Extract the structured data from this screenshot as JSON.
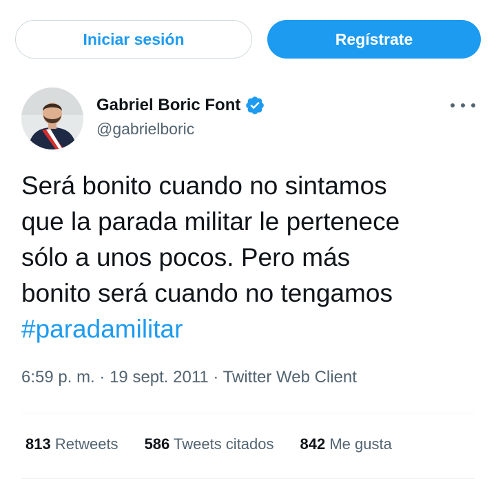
{
  "auth": {
    "login_label": "Iniciar sesión",
    "signup_label": "Regístrate"
  },
  "author": {
    "name": "Gabriel Boric Font",
    "handle": "@gabrielboric",
    "verified": true,
    "avatar_icon": "profile-photo"
  },
  "tweet": {
    "text_lines": [
      "Será bonito cuando no sintamos",
      "que la parada militar le pertenece",
      "sólo a unos pocos. Pero más",
      "bonito será cuando no tengamos"
    ],
    "hashtag": "#paradamilitar",
    "time": "6:59 p. m.",
    "date": "19 sept. 2011",
    "source": "Twitter Web Client"
  },
  "stats": {
    "retweets_count": "813",
    "retweets_label": "Retweets",
    "quotes_count": "586",
    "quotes_label": "Tweets citados",
    "likes_count": "842",
    "likes_label": "Me gusta"
  },
  "colors": {
    "accent": "#1d9bf0",
    "text_primary": "#0f1419",
    "text_secondary": "#536471"
  }
}
